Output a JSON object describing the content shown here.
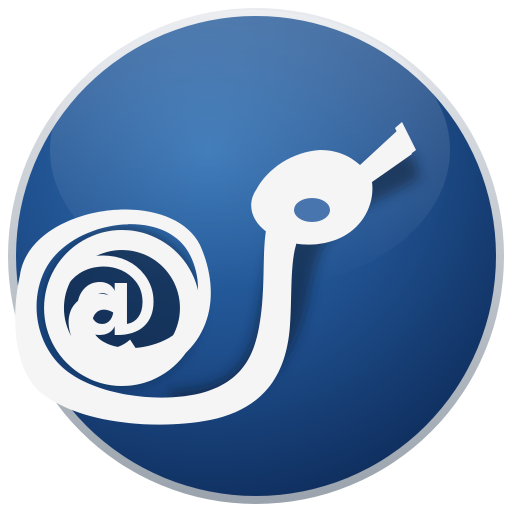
{
  "icon": {
    "name": "email-fuel-pump-nozzle-app-icon",
    "symbol": "@",
    "colors": {
      "background_edge": "#0f2f5f",
      "background_mid": "#1f4f8d",
      "background_highlight": "#2e6fb3",
      "rim": "#d7dbe0",
      "symbol": "#f5f5f5",
      "shadow": "#0a1a33"
    }
  }
}
